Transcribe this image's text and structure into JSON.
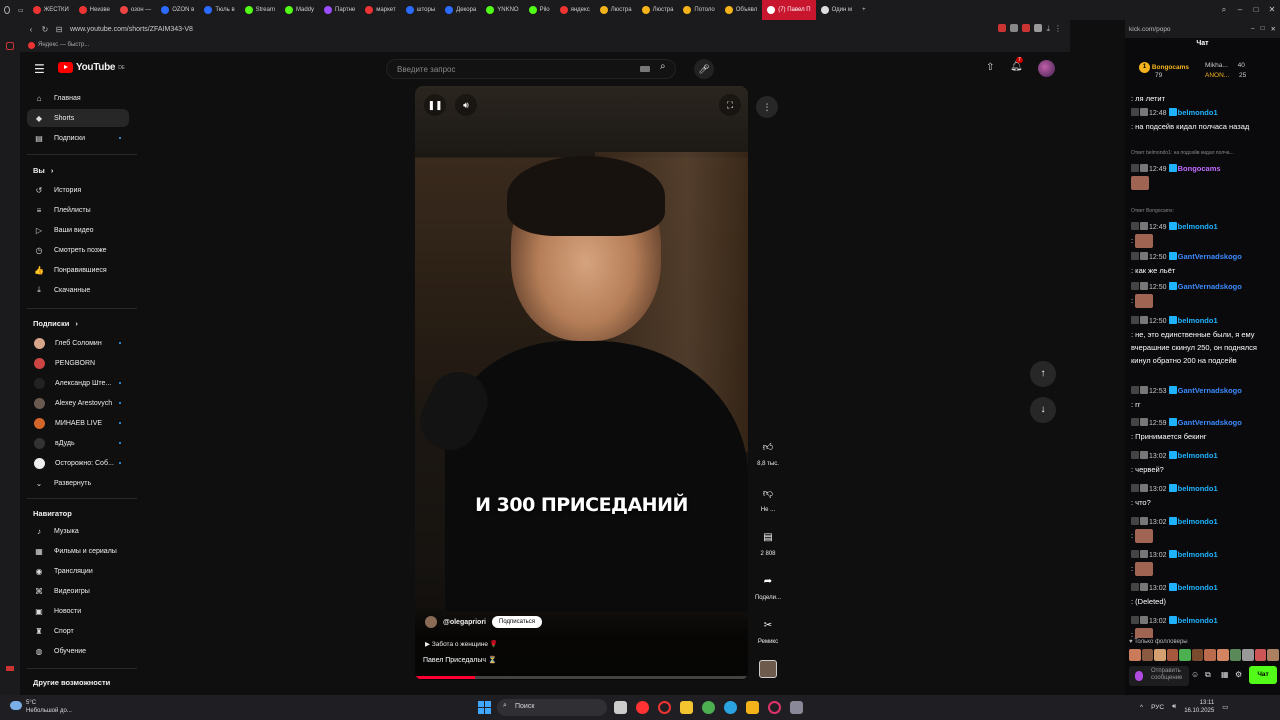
{
  "browser": {
    "tabs": [
      {
        "label": "ЖЕСТКИ",
        "color": "#e33"
      },
      {
        "label": "Неизве",
        "color": "#e33"
      },
      {
        "label": "озон —",
        "color": "#e44"
      },
      {
        "label": "OZON в",
        "color": "#2b6bff"
      },
      {
        "label": "Тюль в",
        "color": "#2b6bff"
      },
      {
        "label": "Stream",
        "color": "#53fc18"
      },
      {
        "label": "Maddy",
        "color": "#53fc18"
      },
      {
        "label": "Партне",
        "color": "#9b4dff"
      },
      {
        "label": "маркет",
        "color": "#e33"
      },
      {
        "label": "шторы",
        "color": "#2b6bff"
      },
      {
        "label": "Декора",
        "color": "#2b6bff"
      },
      {
        "label": "YNKNO",
        "color": "#53fc18"
      },
      {
        "label": "Pilo",
        "color": "#53fc18"
      },
      {
        "label": "яндекс",
        "color": "#e33"
      },
      {
        "label": "Люстра",
        "color": "#f4b31a"
      },
      {
        "label": "Люстра",
        "color": "#f4b31a"
      },
      {
        "label": "Потоло",
        "color": "#f4b31a"
      },
      {
        "label": "Объявл",
        "color": "#f4b31a"
      },
      {
        "label": "(7) Павел П",
        "color": "#fff",
        "active": true
      },
      {
        "label": "Один м",
        "color": "#ddd"
      }
    ],
    "url": "www.youtube.com/shorts/ZFAIM343-V8",
    "bookmark": "Яндекс — быстр...",
    "kick_url": "kick.com/popo"
  },
  "youtube": {
    "logo_text": "YouTube",
    "logo_region": "DE",
    "search_placeholder": "Введите запрос",
    "notif_count": "7",
    "sidebar": {
      "main": [
        {
          "label": "Главная",
          "icon": "home-icon",
          "glyph": "⌂"
        },
        {
          "label": "Shorts",
          "icon": "shorts-icon",
          "glyph": "◆",
          "active": true
        },
        {
          "label": "Подписки",
          "icon": "subscriptions-icon",
          "glyph": "▤",
          "dot": true
        }
      ],
      "you_header": "Вы",
      "you": [
        {
          "label": "История",
          "icon": "history-icon",
          "glyph": "↺"
        },
        {
          "label": "Плейлисты",
          "icon": "playlists-icon",
          "glyph": "≡"
        },
        {
          "label": "Ваши видео",
          "icon": "your-videos-icon",
          "glyph": "▷"
        },
        {
          "label": "Смотреть позже",
          "icon": "watch-later-icon",
          "glyph": "◷"
        },
        {
          "label": "Понравившиеся",
          "icon": "liked-icon",
          "glyph": "👍"
        },
        {
          "label": "Скачанные",
          "icon": "downloads-icon",
          "glyph": "⤓"
        }
      ],
      "subs_header": "Подписки",
      "subs": [
        {
          "label": "Глеб Соломин",
          "color": "#d9a58a",
          "dot": true
        },
        {
          "label": "PENGBORN",
          "color": "#c44"
        },
        {
          "label": "Александр Ште...",
          "color": "#222",
          "dot": true
        },
        {
          "label": "Alexey Arestovych",
          "color": "#6a5a50",
          "dot": true
        },
        {
          "label": "МИНАЕВ LIVE",
          "color": "#d4652a",
          "dot": true
        },
        {
          "label": "вДудь",
          "color": "#333",
          "dot": true
        },
        {
          "label": "Осторожно: Соб...",
          "color": "#eee",
          "dot": true
        }
      ],
      "expand_label": "Развернуть",
      "nav_header": "Навигатор",
      "nav": [
        {
          "label": "Музыка",
          "icon": "music-icon",
          "glyph": "♪"
        },
        {
          "label": "Фильмы и сериалы",
          "icon": "movies-icon",
          "glyph": "▦"
        },
        {
          "label": "Трансляции",
          "icon": "live-icon",
          "glyph": "◉"
        },
        {
          "label": "Видеоигры",
          "icon": "gaming-icon",
          "glyph": "⌘"
        },
        {
          "label": "Новости",
          "icon": "news-icon",
          "glyph": "▣"
        },
        {
          "label": "Спорт",
          "icon": "sport-icon",
          "glyph": "♜"
        },
        {
          "label": "Обучение",
          "icon": "learning-icon",
          "glyph": "◍"
        }
      ],
      "more_header": "Другие возможности"
    },
    "short": {
      "caption": "И 300 ПРИСЕДАНИЙ",
      "channel": "@olegapriori",
      "subscribe": "Подписаться",
      "music": "Забота о женщине 🌹",
      "title": "Павел Приседалыч ⏳",
      "progress": 0.18
    },
    "actions": {
      "likes": "8,8 тыс.",
      "dislike": "Не ...",
      "comments": "2 808",
      "share": "Подели...",
      "remix": "Ремикс"
    }
  },
  "kick": {
    "chat_title": "Чат",
    "pinned": {
      "rank": "1",
      "name": "Bongocams",
      "amount": "79",
      "others": [
        {
          "name": "Mikha...",
          "amount": "40"
        },
        {
          "name": "ANON...",
          "amount": "25"
        }
      ]
    },
    "messages": [
      {
        "text": ": ля летит"
      },
      {
        "time": "12:48",
        "nick": "belmondo1",
        "text": ": на подсейв кидал полчаса назад"
      },
      {
        "reply": "Ответ belmondo1: на подсейв кидал полча..."
      },
      {
        "time": "12:49",
        "nick": "Bongocams",
        "text": ""
      },
      {
        "reply": "Ответ Bongocams:"
      },
      {
        "time": "12:49",
        "nick": "belmondo1",
        "text": ":"
      },
      {
        "time": "12:50",
        "nick": "GantVernadskogo",
        "text": ": как же льёт"
      },
      {
        "time": "12:50",
        "nick": "GantVernadskogo",
        "text": ":"
      },
      {
        "time": "12:50",
        "nick": "belmondo1",
        "text": ": не, это единственные были, я ему вчерашние скинул 250, он поднялся кинул обратно 200 на подсейв"
      },
      {
        "time": "12:53",
        "nick": "GantVernadskogo",
        "text": ": гг"
      },
      {
        "time": "12:59",
        "nick": "GantVernadskogo",
        "text": ": Принимается бекинг"
      },
      {
        "time": "13:02",
        "nick": "belmondo1",
        "text": ": червей?"
      },
      {
        "time": "13:02",
        "nick": "belmondo1",
        "text": ": что?"
      },
      {
        "time": "13:02",
        "nick": "belmondo1",
        "text": ":"
      },
      {
        "time": "13:02",
        "nick": "belmondo1",
        "text": ":"
      },
      {
        "time": "13:02",
        "nick": "belmondo1",
        "text": ": (Deleted)"
      },
      {
        "time": "13:02",
        "nick": "belmondo1",
        "text": ":"
      }
    ],
    "followers_only": "Только фолловеры",
    "input_placeholder": "Отправить сообщение",
    "send": "Чат"
  },
  "taskbar": {
    "temp": "5°C",
    "weather": "Небольшой до...",
    "search": "Поиск",
    "lang": "РУС",
    "time": "13:11",
    "date": "16.10.2025"
  }
}
